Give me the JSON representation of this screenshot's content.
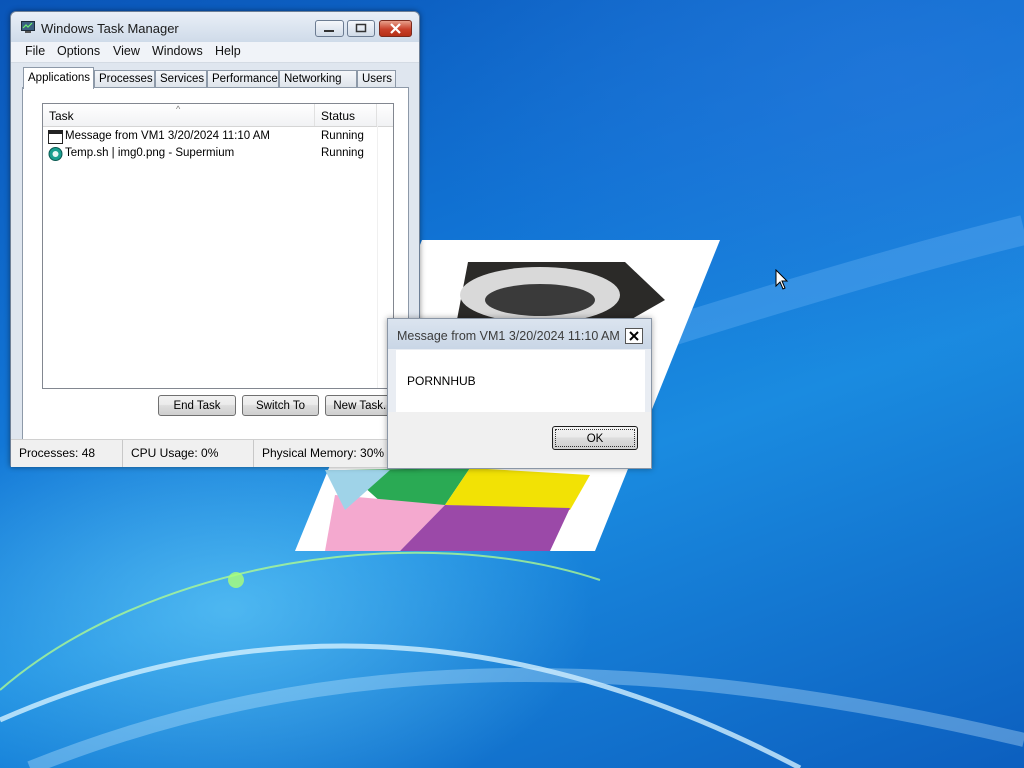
{
  "colors": {
    "desktop": "#1173d4",
    "close_button": "#c8402a"
  },
  "taskman": {
    "title": "Windows Task Manager",
    "caption_icons": [
      "minimize-icon",
      "maximize-icon",
      "close-icon"
    ],
    "menu": [
      "File",
      "Options",
      "View",
      "Windows",
      "Help"
    ],
    "tabs": [
      "Applications",
      "Processes",
      "Services",
      "Performance",
      "Networking",
      "Users"
    ],
    "active_tab": "Applications",
    "columns": {
      "task": "Task",
      "status": "Status"
    },
    "rows": [
      {
        "task": "Message from VM1 3/20/2024 11:10 AM",
        "status": "Running",
        "icon": "window-icon"
      },
      {
        "task": "Temp.sh | img0.png - Supermium",
        "status": "Running",
        "icon": "browser-icon"
      }
    ],
    "buttons": {
      "end_task": "End Task",
      "switch_to": "Switch To",
      "new_task": "New Task..."
    },
    "status": {
      "processes": "Processes: 48",
      "cpu": "CPU Usage: 0%",
      "memory": "Physical Memory: 30%"
    }
  },
  "msgbox": {
    "title": "Message from VM1 3/20/2024 11:10 AM",
    "text": "PORNNHUB",
    "ok": "OK"
  }
}
